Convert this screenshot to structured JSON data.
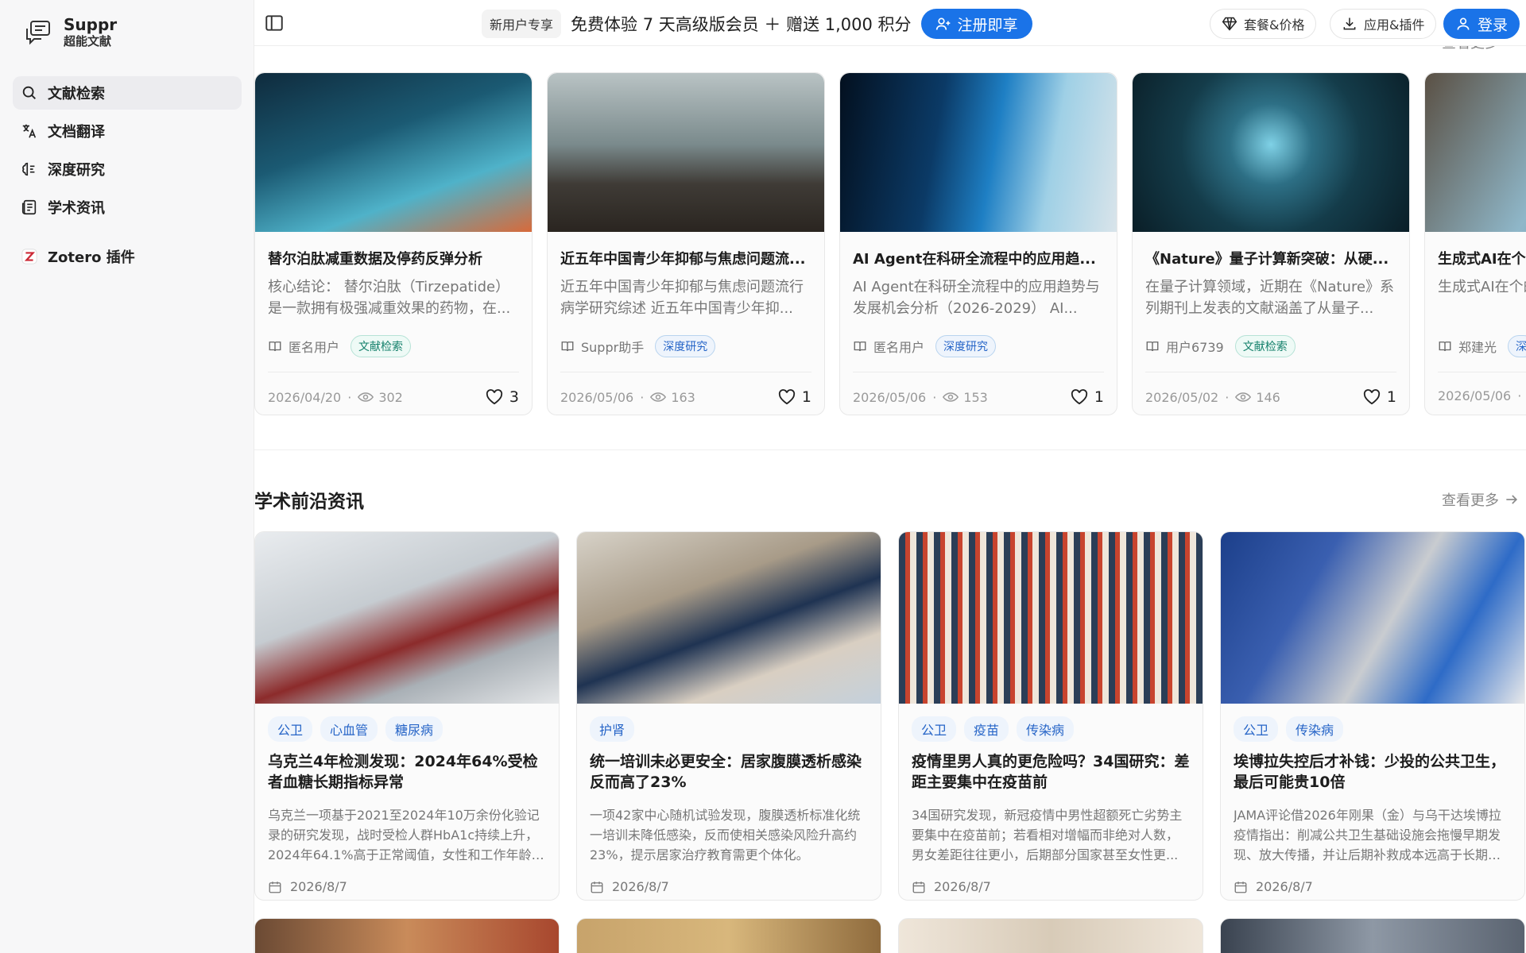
{
  "brand": {
    "name": "Suppr",
    "subtitle": "超能文献"
  },
  "sidebar": {
    "items": [
      {
        "label": "文献检索",
        "icon": "search-icon",
        "active": true
      },
      {
        "label": "文档翻译",
        "icon": "translate-icon",
        "active": false
      },
      {
        "label": "深度研究",
        "icon": "brain-icon",
        "active": false
      },
      {
        "label": "学术资讯",
        "icon": "news-icon",
        "active": false
      }
    ],
    "plugin": {
      "label": "Zotero 插件",
      "icon": "zotero-icon"
    }
  },
  "topbar": {
    "promo_pill": "新用户专享",
    "promo_text": "免费体验 7 天高级版会员 ＋ 赠送 1,000 积分",
    "promo_cta": "注册即享",
    "pricing": "套餐&价格",
    "apps": "应用&插件",
    "login": "登录"
  },
  "research_section": {
    "more_label": "查看更多",
    "cards": [
      {
        "title": "替尔泊肽减重数据及停药反弹分析",
        "desc": "核心结论： 替尔泊肽（Tirzepatide）是一款拥有极强减重效果的药物，在...",
        "author": "匿名用户",
        "tag": "文献检索",
        "date": "2026/04/20",
        "views": "302",
        "likes": "3"
      },
      {
        "title": "近五年中国青少年抑郁与焦虑问题流...",
        "desc": "近五年中国青少年抑郁与焦虑问题流行病学研究综述 近五年中国青少年抑...",
        "author": "Suppr助手",
        "tag": "深度研究",
        "date": "2026/05/06",
        "views": "163",
        "likes": "1"
      },
      {
        "title": "AI Agent在科研全流程中的应用趋...",
        "desc": "AI Agent在科研全流程中的应用趋势与发展机会分析（2026-2029） AI...",
        "author": "匿名用户",
        "tag": "深度研究",
        "date": "2026/05/06",
        "views": "153",
        "likes": "1"
      },
      {
        "title": "《Nature》量子计算新突破：从硬...",
        "desc": "在量子计算领域，近期在《Nature》系列期刊上发表的文献涵盖了从量子...",
        "author": "用户6739",
        "tag": "文献检索",
        "date": "2026/05/02",
        "views": "146",
        "likes": "1"
      },
      {
        "title": "生成式AI在个",
        "desc": "生成式AI在个的研究进展：",
        "author": "郑建光",
        "tag": "深",
        "date": "2026/05/06",
        "views": "",
        "likes": ""
      }
    ]
  },
  "news_section": {
    "title": "学术前沿资讯",
    "more_label": "查看更多",
    "cards": [
      {
        "tags": [
          "公卫",
          "心血管",
          "糖尿病"
        ],
        "title": "乌克兰4年检测发现：2024年64%受检者血糖长期指标异常",
        "desc": "乌克兰一项基于2021至2024年10万余份化验记录的研究发现，战时受检人群HbA1c持续上升，2024年64.1%高于正常阈值，女性和工作年龄成...",
        "date": "2026/8/7"
      },
      {
        "tags": [
          "护肾"
        ],
        "title": "统一培训未必更安全：居家腹膜透析感染反而高了23%",
        "desc": "一项42家中心随机试验发现，腹膜透析标准化统一培训未降低感染，反而使相关感染风险升高约23%，提示居家治疗教育需更个体化。",
        "date": "2026/8/7"
      },
      {
        "tags": [
          "公卫",
          "疫苗",
          "传染病"
        ],
        "title": "疫情里男人真的更危险吗？34国研究：差距主要集中在疫苗前",
        "desc": "34国研究发现，新冠疫情中男性超额死亡劣势主要集中在疫苗前；若看相对增幅而非绝对人数，男女差距往往更小，后期部分国家甚至女性更...",
        "date": "2026/8/7"
      },
      {
        "tags": [
          "公卫",
          "传染病"
        ],
        "title": "埃博拉失控后才补钱：少投的公共卫生，最后可能贵10倍",
        "desc": "JAMA评论借2026年刚果（金）与乌干达埃博拉疫情指出：削减公共卫生基础设施会拖慢早期发现、放大传播，并让后期补救成本远高于长期投...",
        "date": "2026/8/7"
      }
    ]
  }
}
